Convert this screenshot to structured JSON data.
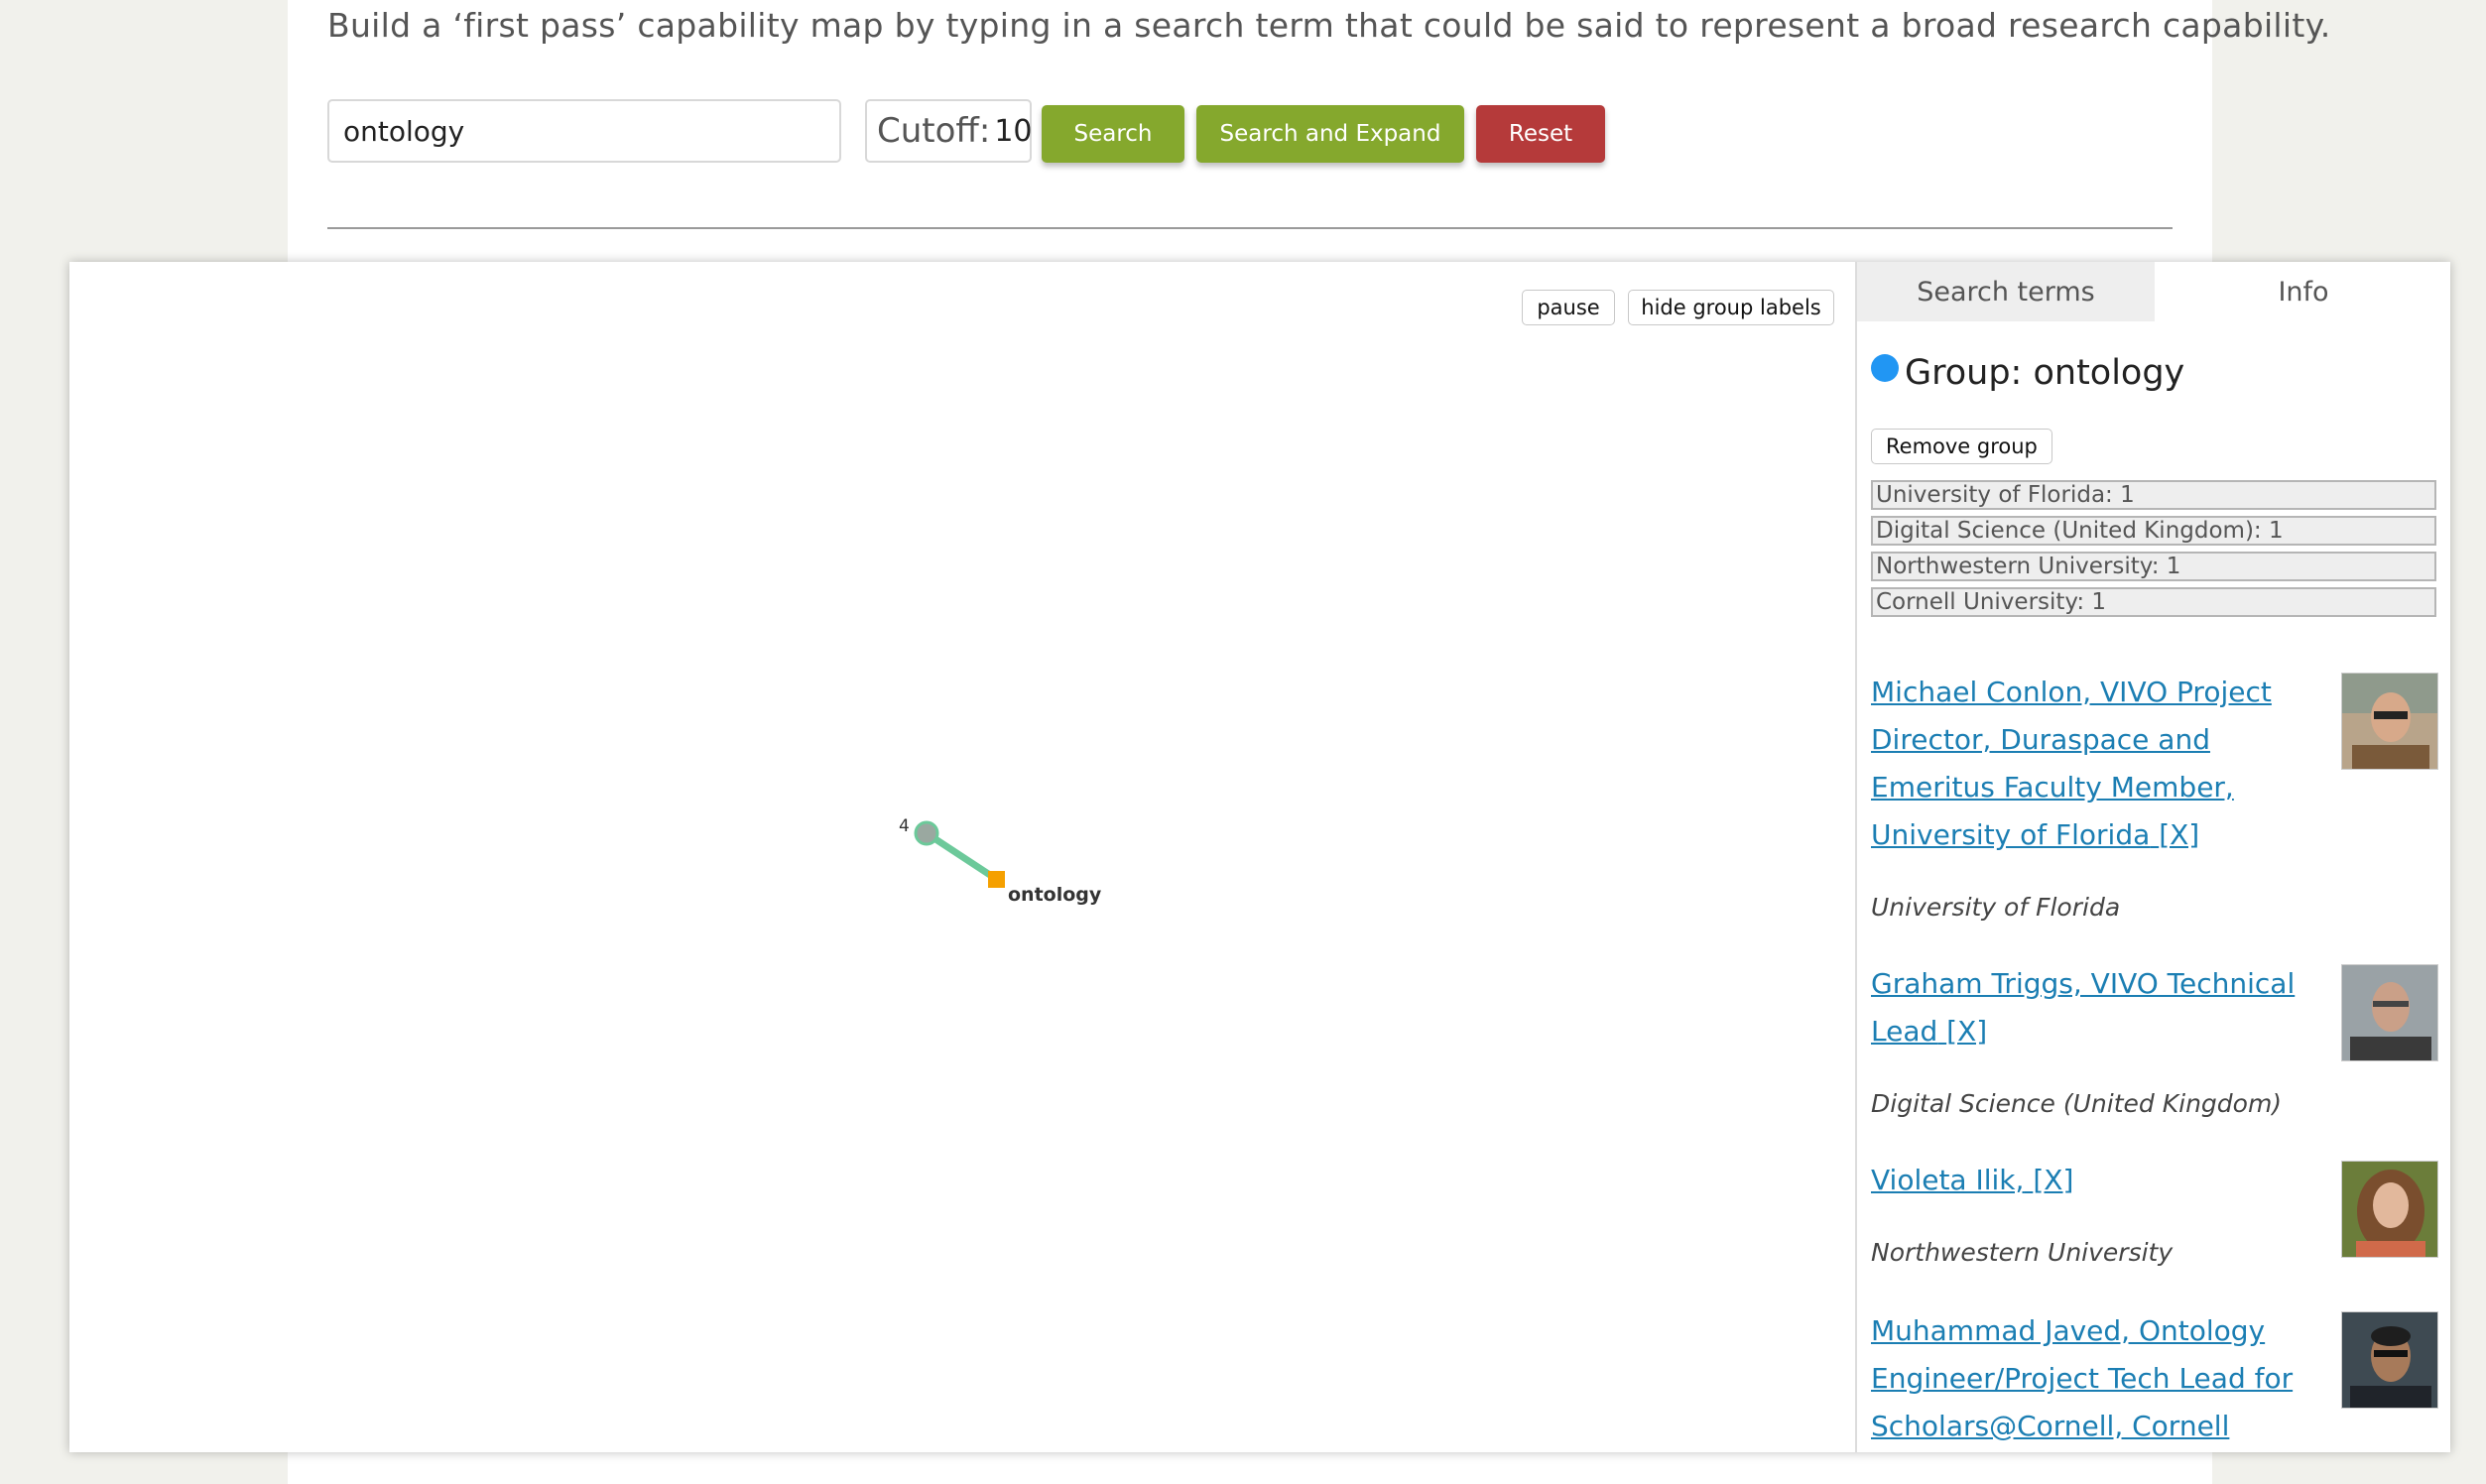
{
  "intro_text": "Build a ‘first pass’ capability map by typing in a search term that could be said to represent a broad research capability.",
  "search": {
    "value": "ontology"
  },
  "cutoff": {
    "label": "Cutoff:",
    "value": "10"
  },
  "buttons": {
    "search": "Search",
    "search_expand": "Search and Expand",
    "reset": "Reset"
  },
  "graph": {
    "pause_label": "pause",
    "hide_labels_label": "hide group labels",
    "node_count": "4",
    "group_label": "ontology",
    "colors": {
      "edge": "#6cc99a",
      "node": "#9aa8a0",
      "group": "#f5a000"
    }
  },
  "sidebar": {
    "tabs": [
      {
        "label": "Search terms"
      },
      {
        "label": "Info"
      }
    ],
    "group_title": "Group: ontology",
    "group_color": "#2196f3",
    "remove_group_label": "Remove group",
    "counts": [
      "University of Florida: 1",
      "Digital Science (United Kingdom): 1",
      "Northwestern University: 1",
      "Cornell University: 1"
    ],
    "people": [
      {
        "name": "Michael Conlon, VIVO Project Director, Duraspace and Emeritus Faculty Member, University of Florida",
        "remove": "[X]",
        "institution": "University of Florida"
      },
      {
        "name": "Graham Triggs, VIVO Technical Lead",
        "remove": "[X]",
        "institution": "Digital Science (United Kingdom)"
      },
      {
        "name": "Violeta Ilik,",
        "remove": "[X]",
        "institution": "Northwestern University"
      },
      {
        "name": "Muhammad Javed, Ontology Engineer/Project Tech Lead for Scholars@Cornell, Cornell",
        "remove": "",
        "institution": ""
      }
    ]
  }
}
